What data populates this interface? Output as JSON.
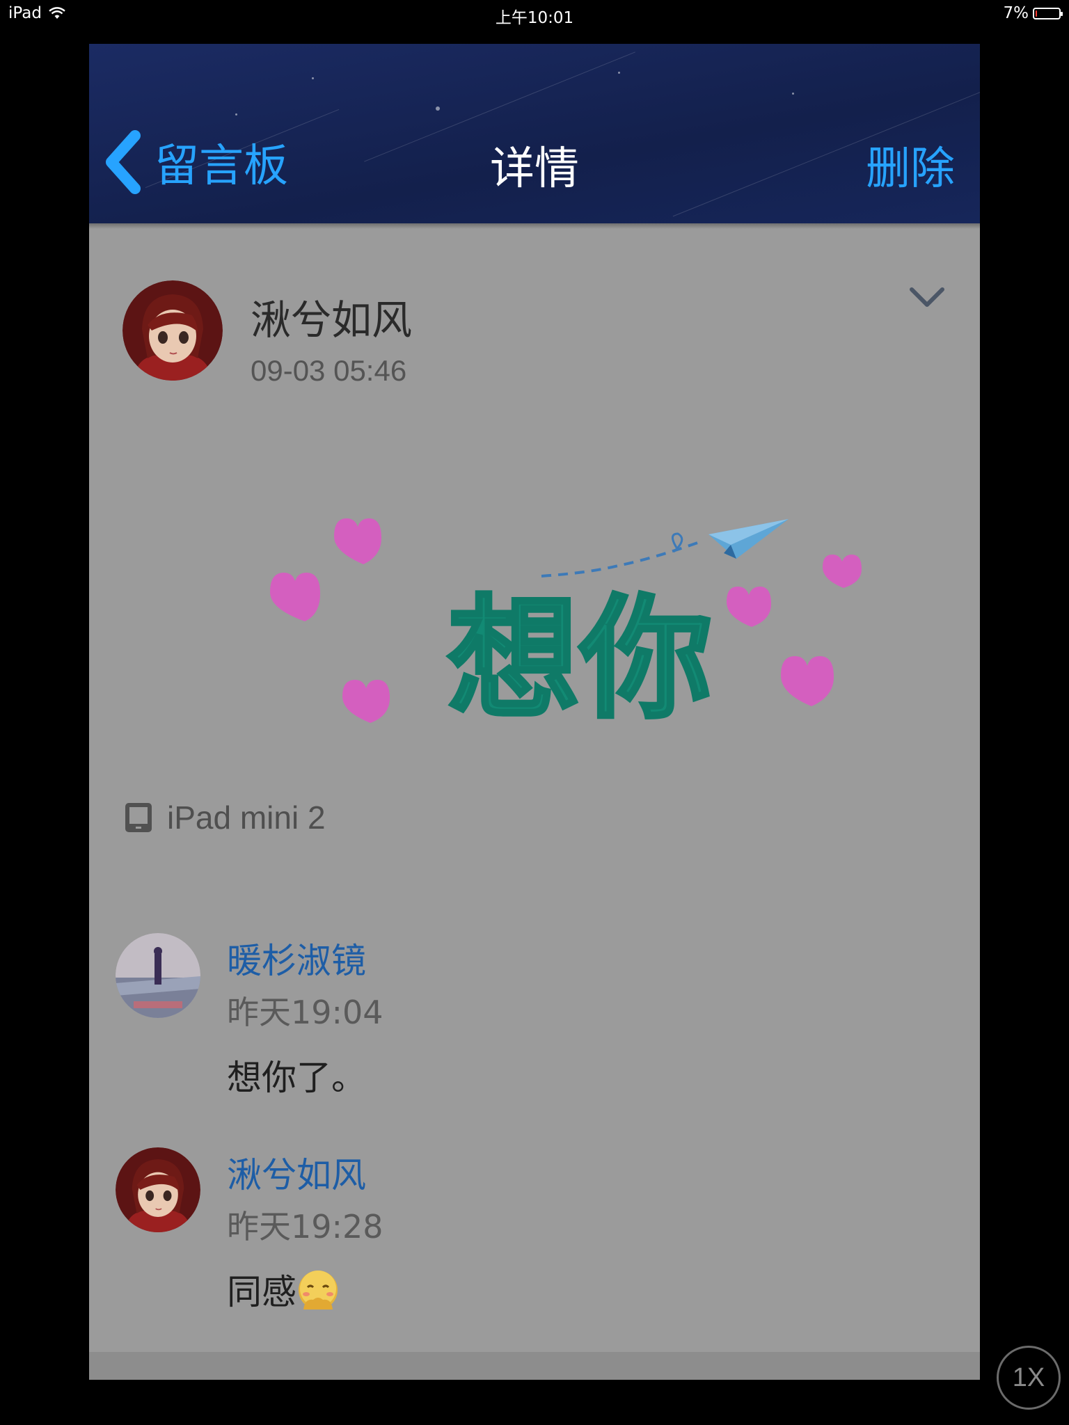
{
  "status_bar": {
    "device": "iPad",
    "time": "上午10:01",
    "battery_text": "7%",
    "battery_level": 0.07,
    "battery_color": "#ff3b30"
  },
  "nav": {
    "back_label": "留言板",
    "title": "详情",
    "action_label": "删除",
    "accent_color": "#27a3ff",
    "back_icon": "chevron-left-icon"
  },
  "post": {
    "author": "湫兮如风",
    "time": "09-03 05:46",
    "menu_icon": "chevron-down-icon",
    "sticker_text": "想你",
    "device_icon": "tablet-icon",
    "device": "iPad mini 2"
  },
  "comments": [
    {
      "name": "暖杉淑镜",
      "time": "昨天19:04",
      "text": "想你了。"
    },
    {
      "name": "湫兮如风",
      "time": "昨天19:28",
      "text": "同感",
      "emoji_icon": "shy-face-emoji-icon"
    }
  ],
  "zoom_badge": "1X"
}
